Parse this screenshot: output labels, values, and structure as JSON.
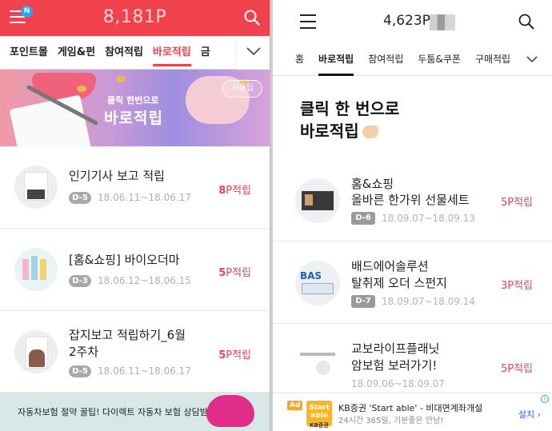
{
  "left": {
    "header": {
      "badge": "N",
      "points": "8,181P"
    },
    "tabs": [
      {
        "label": "포인트몰",
        "active": false
      },
      {
        "label": "게임&펀",
        "active": false
      },
      {
        "label": "참여적립",
        "active": false
      },
      {
        "label": "바로적립",
        "active": true
      },
      {
        "label": "금",
        "active": false
      }
    ],
    "banner": {
      "line1": "클릭 한번으로",
      "line2": "바로적립",
      "use_button": "사용팁"
    },
    "items": [
      {
        "title": "인기기사 보고 적립",
        "dday": "D-5",
        "date": "18.06.11~18.06.17",
        "points": "8",
        "unit": "P적립"
      },
      {
        "title": "[홈&쇼핑] 바이오더마",
        "dday": "D-3",
        "date": "18.06.12~18.06.15",
        "points": "5",
        "unit": "P적립"
      },
      {
        "title": "잡지보고 적립하기_6월",
        "title2": "2주차",
        "dday": "D-5",
        "date": "18.06.11~18.06.17",
        "points": "5",
        "unit": "P적립"
      }
    ],
    "bottom_banner": "자동차보험 절약 꿀팁! 다이렉트 자동차 보험 상담받기"
  },
  "right": {
    "header": {
      "points": "4,623P"
    },
    "tabs": [
      {
        "label": "홈",
        "active": false
      },
      {
        "label": "바로적립",
        "active": true
      },
      {
        "label": "참여적립",
        "active": false
      },
      {
        "label": "두툼&쿠폰",
        "active": false
      },
      {
        "label": "구매적립",
        "active": false
      }
    ],
    "heading": {
      "line1": "클릭 한 번으로",
      "line2": "바로적립"
    },
    "items": [
      {
        "line1": "홈&쇼핑",
        "line2": "올바른 한가위 선물세트",
        "dday": "D-6",
        "date": "18.09.07~18.09.13",
        "points": "5",
        "unit": "P적립"
      },
      {
        "line1": "배드에어솔루션",
        "line2": "탈취제 오더 스펀지",
        "dday": "D-7",
        "date": "18.09.07~18.09.14",
        "points": "3",
        "unit": "P적립"
      },
      {
        "line1": "교보라이프플래닛",
        "line2": "암보험 보러가기!",
        "dday": "",
        "date": "18.09.06~18.09.07",
        "points": "5",
        "unit": "P적립"
      }
    ],
    "ad": {
      "tag": "Ad",
      "logo_line1": "Start",
      "logo_line2": "able",
      "logo_brand": "KB증권",
      "title": "KB증권 'Start able' - 비대면계좌개설",
      "subtitle": "24시간 365일, 기분좋은 만남!",
      "install": "설치 ›"
    }
  },
  "colors": {
    "accent_red": "#f0424d",
    "badge_blue": "#2aa4f4"
  }
}
